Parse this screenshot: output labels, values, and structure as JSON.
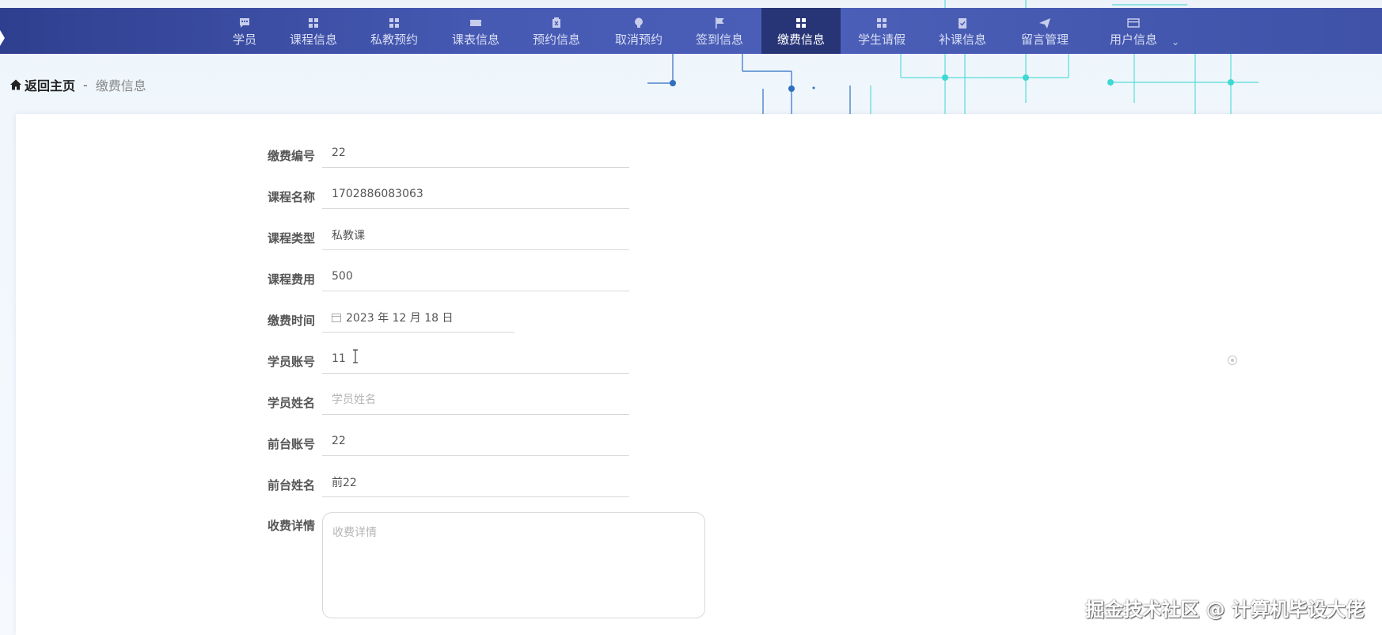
{
  "nav": {
    "items": [
      {
        "label": "学员",
        "icon": "chat-icon"
      },
      {
        "label": "课程信息",
        "icon": "grid-icon"
      },
      {
        "label": "私教预约",
        "icon": "grid-icon"
      },
      {
        "label": "课表信息",
        "icon": "ticket-icon"
      },
      {
        "label": "预约信息",
        "icon": "delete-box-icon"
      },
      {
        "label": "取消预约",
        "icon": "bulb-icon"
      },
      {
        "label": "签到信息",
        "icon": "flag-icon"
      },
      {
        "label": "缴费信息",
        "icon": "grid-icon"
      },
      {
        "label": "学生请假",
        "icon": "grid-icon"
      },
      {
        "label": "补课信息",
        "icon": "clipboard-icon"
      },
      {
        "label": "留言管理",
        "icon": "send-icon"
      },
      {
        "label": "用户信息",
        "icon": "card-icon"
      }
    ],
    "active_index": 7
  },
  "breadcrumb": {
    "home": "返回主页",
    "separator": "-",
    "current": "缴费信息"
  },
  "form": {
    "payment_no": {
      "label": "缴费编号",
      "value": "22"
    },
    "course_name": {
      "label": "课程名称",
      "value": "1702886083063"
    },
    "course_type": {
      "label": "课程类型",
      "value": "私教课"
    },
    "course_fee": {
      "label": "课程费用",
      "value": "500"
    },
    "payment_time": {
      "label": "缴费时间",
      "value": "2023 年 12 月 18 日"
    },
    "student_account": {
      "label": "学员账号",
      "value": "11"
    },
    "student_name": {
      "label": "学员姓名",
      "value": "",
      "placeholder": "学员姓名"
    },
    "reception_account": {
      "label": "前台账号",
      "value": "22"
    },
    "reception_name": {
      "label": "前台姓名",
      "value": "前22"
    },
    "fee_details": {
      "label": "收费详情",
      "value": "",
      "placeholder": "收费详情"
    }
  },
  "watermark": "掘金技术社区 @ 计算机毕设大佬",
  "colors": {
    "nav_bg": "#4659b3",
    "nav_active": "#273475",
    "circuit": "#3fd8d2"
  }
}
